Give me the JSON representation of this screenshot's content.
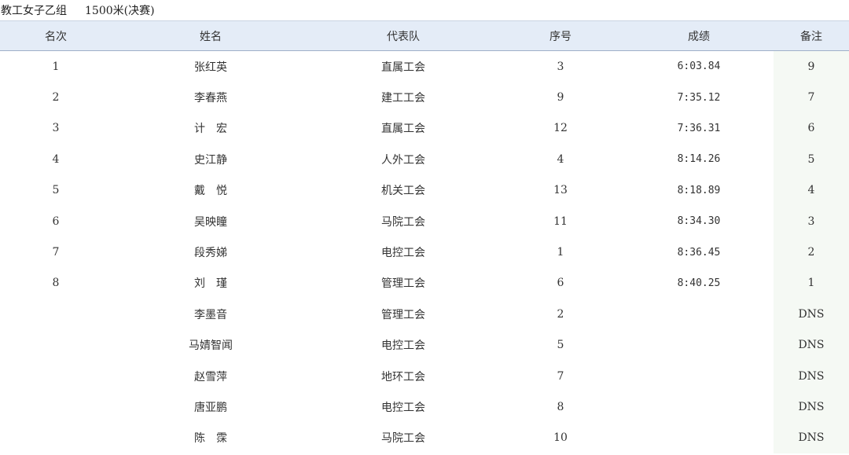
{
  "header": {
    "event_group": "教工女子乙组",
    "event_name": "1500米(决赛)"
  },
  "table": {
    "columns": {
      "rank": "名次",
      "name": "姓名",
      "team": "代表队",
      "lane": "序号",
      "time": "成绩",
      "note": "备注"
    },
    "rows": [
      {
        "rank": "1",
        "name": "张红英",
        "team": "直属工会",
        "lane": "3",
        "time": "6:03.84",
        "note": "9"
      },
      {
        "rank": "2",
        "name": "李春燕",
        "team": "建工工会",
        "lane": "9",
        "time": "7:35.12",
        "note": "7"
      },
      {
        "rank": "3",
        "name": "计　宏",
        "team": "直属工会",
        "lane": "12",
        "time": "7:36.31",
        "note": "6"
      },
      {
        "rank": "4",
        "name": "史江静",
        "team": "人外工会",
        "lane": "4",
        "time": "8:14.26",
        "note": "5"
      },
      {
        "rank": "5",
        "name": "戴　悦",
        "team": "机关工会",
        "lane": "13",
        "time": "8:18.89",
        "note": "4"
      },
      {
        "rank": "6",
        "name": "吴映瞳",
        "team": "马院工会",
        "lane": "11",
        "time": "8:34.30",
        "note": "3"
      },
      {
        "rank": "7",
        "name": "段秀娣",
        "team": "电控工会",
        "lane": "1",
        "time": "8:36.45",
        "note": "2"
      },
      {
        "rank": "8",
        "name": "刘　瑾",
        "team": "管理工会",
        "lane": "6",
        "time": "8:40.25",
        "note": "1"
      },
      {
        "rank": "",
        "name": "李墨音",
        "team": "管理工会",
        "lane": "2",
        "time": "",
        "note": "DNS"
      },
      {
        "rank": "",
        "name": "马婧智闻",
        "team": "电控工会",
        "lane": "5",
        "time": "",
        "note": "DNS"
      },
      {
        "rank": "",
        "name": "赵雪萍",
        "team": "地环工会",
        "lane": "7",
        "time": "",
        "note": "DNS"
      },
      {
        "rank": "",
        "name": "唐亚鹏",
        "team": "电控工会",
        "lane": "8",
        "time": "",
        "note": "DNS"
      },
      {
        "rank": "",
        "name": "陈　霂",
        "team": "马院工会",
        "lane": "10",
        "time": "",
        "note": "DNS"
      }
    ]
  }
}
